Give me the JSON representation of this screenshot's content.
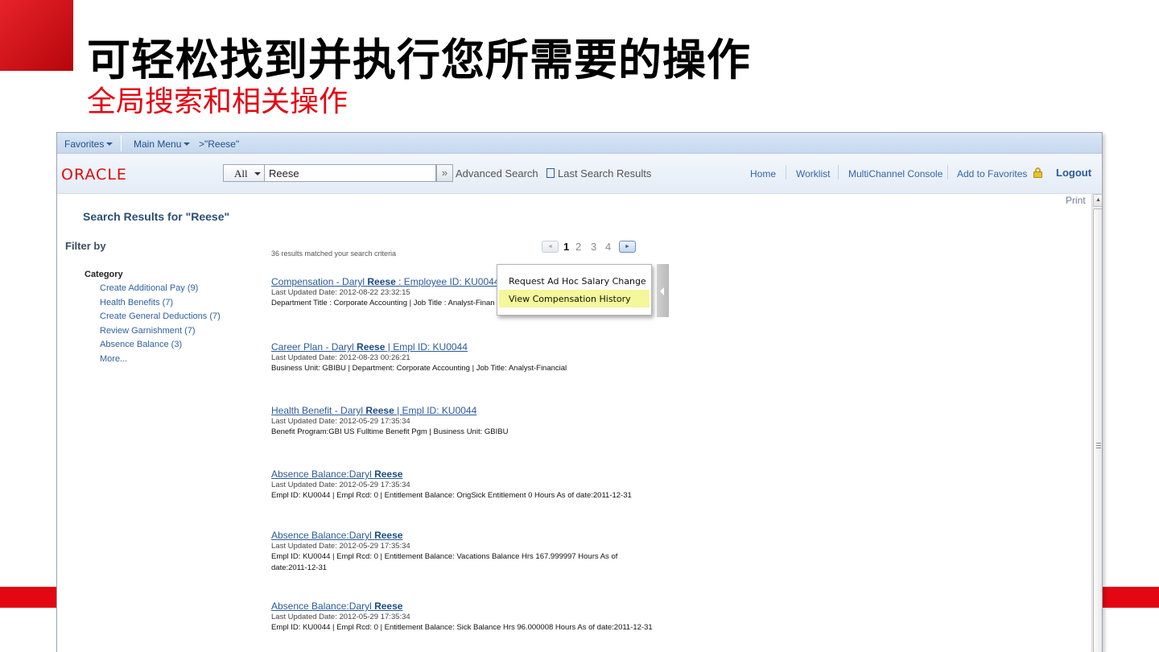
{
  "slide": {
    "title": "可轻松找到并执行您所需要的操作",
    "subtitle": "全局搜索和相关操作",
    "accent_color": "#e30613"
  },
  "topbar": {
    "favorites": "Favorites",
    "main_menu": "Main Menu",
    "breadcrumb": ">\"Reese\""
  },
  "header": {
    "logo": "ORACLE",
    "scope": "All",
    "search_value": "Reese",
    "go_icon": "»",
    "advanced_search": "Advanced Search",
    "last_search_results": "Last Search Results",
    "nav": {
      "home": "Home",
      "worklist": "Worklist",
      "multichannel": "MultiChannel Console",
      "add_favorites": "Add to Favorites",
      "logout": "Logout"
    }
  },
  "print": "Print",
  "results_title": "Search Results for \"Reese\"",
  "filter": {
    "title": "Filter by",
    "category_title": "Category",
    "items": [
      "Create Additional Pay (9)",
      "Health Benefits (7)",
      "Create General Deductions (7)",
      "Review Garnishment (7)",
      "Absence Balance (3)",
      "More..."
    ]
  },
  "match_count": "36  results matched your search criteria",
  "pager": {
    "prev_icon": "◄",
    "next_icon": "►",
    "pages": [
      "1",
      "2",
      "3",
      "4"
    ],
    "current": "1"
  },
  "results": [
    {
      "title_pre": "Compensation - Daryl ",
      "title_bold": "Reese",
      "title_post": " : Employee ID: KU0044",
      "date": "Last Updated Date: 2012-08-22 23:32:15",
      "desc": "Department Title : Corporate Accounting | Job Title : Analyst-Finan"
    },
    {
      "title_pre": "Career Plan - Daryl ",
      "title_bold": "Reese",
      "title_post": " | Empl ID: KU0044",
      "date": "Last Updated Date: 2012-08-23 00:26:21",
      "desc": "Business Unit: GBIBU | Department: Corporate Accounting | Job Title: Analyst-Financial"
    },
    {
      "title_pre": "Health Benefit - Daryl ",
      "title_bold": "Reese",
      "title_post": " | Empl ID: KU0044",
      "date": "Last Updated Date: 2012-05-29 17:35:34",
      "desc": "Benefit Program:GBI US Fulltime Benefit Pgm | Business Unit: GBIBU"
    },
    {
      "title_pre": "Absence Balance:Daryl ",
      "title_bold": "Reese",
      "title_post": "",
      "date": "Last Updated Date: 2012-05-29 17:35:34",
      "desc": "Empl ID: KU0044 | Empl Rcd: 0 | Entitlement Balance: OrigSick Entitlement 0 Hours As of date:2011-12-31"
    },
    {
      "title_pre": "Absence Balance:Daryl ",
      "title_bold": "Reese",
      "title_post": "",
      "date": "Last Updated Date: 2012-05-29 17:35:34",
      "desc": "Empl ID: KU0044 | Empl Rcd: 0 | Entitlement Balance: Vacations Balance Hrs 167.999997 Hours As of date:2011-12-31"
    },
    {
      "title_pre": "Absence Balance:Daryl ",
      "title_bold": "Reese",
      "title_post": "",
      "date": "Last Updated Date: 2012-05-29 17:35:34",
      "desc": "Empl ID: KU0044 | Empl Rcd: 0 | Entitlement Balance: Sick Balance Hrs 96.000008 Hours As of date:2011-12-31"
    }
  ],
  "related_actions": {
    "items": [
      "Request Ad Hoc Salary Change",
      "View Compensation History"
    ],
    "hovered_index": 1,
    "hover_color": "#f4f79a"
  }
}
